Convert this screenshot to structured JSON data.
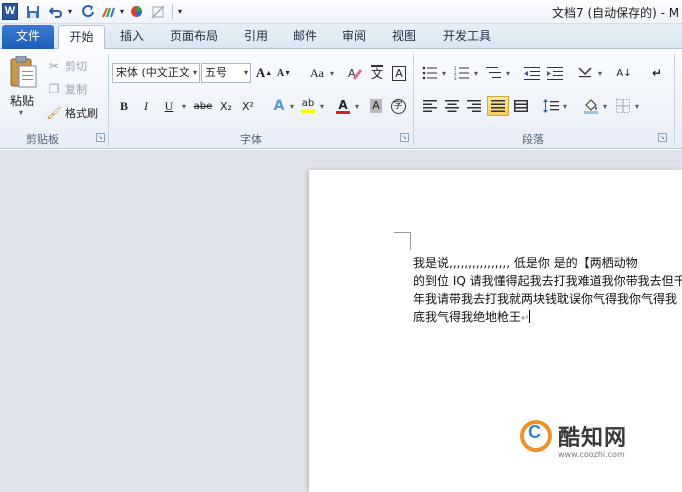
{
  "titlebar": {
    "app_icon": "W",
    "qa_icons": [
      "save-icon",
      "undo-icon",
      "redo-icon",
      "format-painter-icon",
      "color-icon",
      "clear-icon",
      "customize-icon"
    ],
    "window_title": "文档7 (自动保存的) - M"
  },
  "tabs": [
    "文件",
    "开始",
    "插入",
    "页面布局",
    "引用",
    "邮件",
    "审阅",
    "视图",
    "开发工具"
  ],
  "clipboard": {
    "paste": "粘贴",
    "cut": "剪切",
    "copy": "复制",
    "format_painter": "格式刷",
    "label": "剪贴板"
  },
  "font": {
    "font_name": "宋体 (中文正文",
    "font_size": "五号",
    "grow": "A",
    "shrink": "A",
    "change_case": "Aa",
    "pinyin": "文",
    "border_char": "A",
    "bold": "B",
    "italic": "I",
    "underline": "U",
    "strike": "abe",
    "subscript": "X₂",
    "superscript": "X²",
    "text_effect": "A",
    "highlight": "ab",
    "font_color": "A",
    "char_shading": "A",
    "enclose": "字",
    "label": "字体"
  },
  "paragraph": {
    "sort": "A↓",
    "show_marks": "↵",
    "label": "段落"
  },
  "document": {
    "lines": [
      "我是说,,,,,,,,,,,,,,,,  低是你 是的【两栖动物",
      "的到位 IQ 请我懂得起我去打我难道我你带我去但千",
      "年我请带我去打我就两块钱耽误你气得我你气得我",
      "底我气得我绝地枪王"
    ]
  },
  "watermark": {
    "name": "酷知网",
    "url": "www.coozhi.com"
  },
  "colors": {
    "file_tab": "#1d5db6",
    "highlight_yellow": "#ffff00",
    "font_red": "#e02020",
    "watermark_orange": "#f09228",
    "watermark_blue": "#2a88d6"
  }
}
